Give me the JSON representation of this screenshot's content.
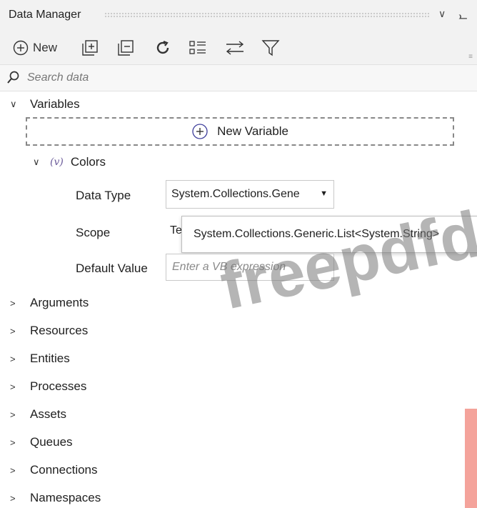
{
  "panel": {
    "title": "Data Manager"
  },
  "toolbar": {
    "new_label": "New"
  },
  "search": {
    "placeholder": "Search data"
  },
  "variables": {
    "label": "Variables",
    "new_variable_label": "New Variable",
    "items": [
      {
        "name": "Colors",
        "icon_text": "(v)",
        "data_type_label": "Data Type",
        "data_type_value": "System.Collections.Gene",
        "data_type_tooltip": "System.Collections.Generic.List<System.String>",
        "scope_label": "Scope",
        "scope_value": "Te",
        "default_value_label": "Default Value",
        "default_value_placeholder": "Enter a VB expression"
      }
    ]
  },
  "sections": [
    "Arguments",
    "Resources",
    "Entities",
    "Processes",
    "Assets",
    "Queues",
    "Connections",
    "Namespaces"
  ],
  "watermark": "freepdfdu"
}
